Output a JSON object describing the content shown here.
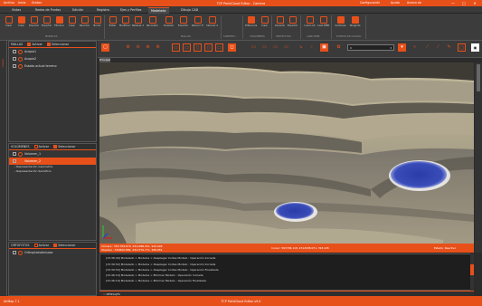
{
  "titlebar": {
    "quick_access": [
      "Archivo",
      "Inicio",
      "Grabar"
    ],
    "title": "TCP PointCloud Editor - Cantera",
    "right_links": [
      "Configuración",
      "Ayuda",
      "Acerca de"
    ],
    "window_buttons": [
      "—",
      "□",
      "✕"
    ]
  },
  "menu": {
    "tabs": [
      "Vistas",
      "Redes de Puntos",
      "Edición",
      "Registro",
      "Ejes y Perfiles",
      "Modelado",
      "Dibujo CAD"
    ],
    "active_tab": "Modelado"
  },
  "ribbon": {
    "buttons_a": [
      "Crear",
      "Crear",
      "Importar",
      "Exportar",
      "Eliminar",
      "Crear",
      "Recortar",
      "Borrar"
    ],
    "group_modelos": "MODELOS",
    "buttons_b": [
      "Editar",
      "Modificar Vertices",
      "Rellenar Agujeros",
      "Reconstruir",
      "Suavizar",
      "Exportar",
      "Reducir Triángulos",
      "Calcular Áreas"
    ],
    "group_mallas": "MALLAS",
    "group_superf": "SUPERFIC...",
    "buttons_c": [
      "Diferencia Modelos",
      "Crear",
      "Importar",
      "Exportar"
    ],
    "group_volumenes": "VOLÚMENES",
    "group_ortofotos": "ORTOFOTOS",
    "lasrmb": [
      "Load LAS",
      "Load RMB"
    ],
    "group_las": "LAND RMB",
    "buttons_d": [
      "Cardones",
      "Tangente"
    ],
    "group_puntos": "PUNTOS DE CAUDAL"
  },
  "left_strip_label": "Capas",
  "panels": {
    "mallas": {
      "header": "MALLAS",
      "chk1": "Activar",
      "chk2": "Seleccionar",
      "items": [
        "Acopio1",
        "Acopio2",
        "Estado actual terreno"
      ]
    },
    "volumenes": {
      "header": "VOLÚMENES",
      "chk1": "Activar",
      "chk2": "Seleccionar",
      "items": [
        "Volumen_1",
        "Volumen_2"
      ],
      "subitems": [
        "Representación Geometría",
        "Representación Semáforo"
      ]
    },
    "ortofotos": {
      "header": "ORTOFOTOS",
      "chk1": "Activar",
      "chk2": "Seleccionar",
      "items": [
        "OrthophotoAnisaac"
      ]
    }
  },
  "viewport": {
    "tab": "Principal",
    "combo_value": "0",
    "status_left_1": "Cámara : 563.769,870, 4312986.051, 920,008",
    "status_left_2": "Objetivo : 563806.889, 4312776.771, 388,959",
    "status_mid": "Cursor: 563796.118, 4312638.071, 393.445",
    "status_right": "Estado: Reactivo"
  },
  "log": {
    "lines": [
      "[15:38:40] Modelado > Modelos > Desplegar Cortes Modelo : Operación Iniciada",
      "[15:39:52] Modelado > Modelos > Desplegar Cortes Modelo : Operación Iniciada",
      "[15:39:53] Modelado > Modelos > Desplegar Cortes Modelo : Operación Finalizada",
      "[15:46:10] Modelado > Modelos > Eliminar Modelo : Operación Iniciada",
      "[15:46:10] Modelado > Modelos > Eliminar Modelo : Operación Finalizada"
    ],
    "footer": "MENSAJES"
  },
  "footer": {
    "left": "AirMap 7.1",
    "center": "TCP PointCloud Editor v9.0"
  },
  "colors": {
    "accent": "#e8501a",
    "volume": "#2a3ca8"
  }
}
